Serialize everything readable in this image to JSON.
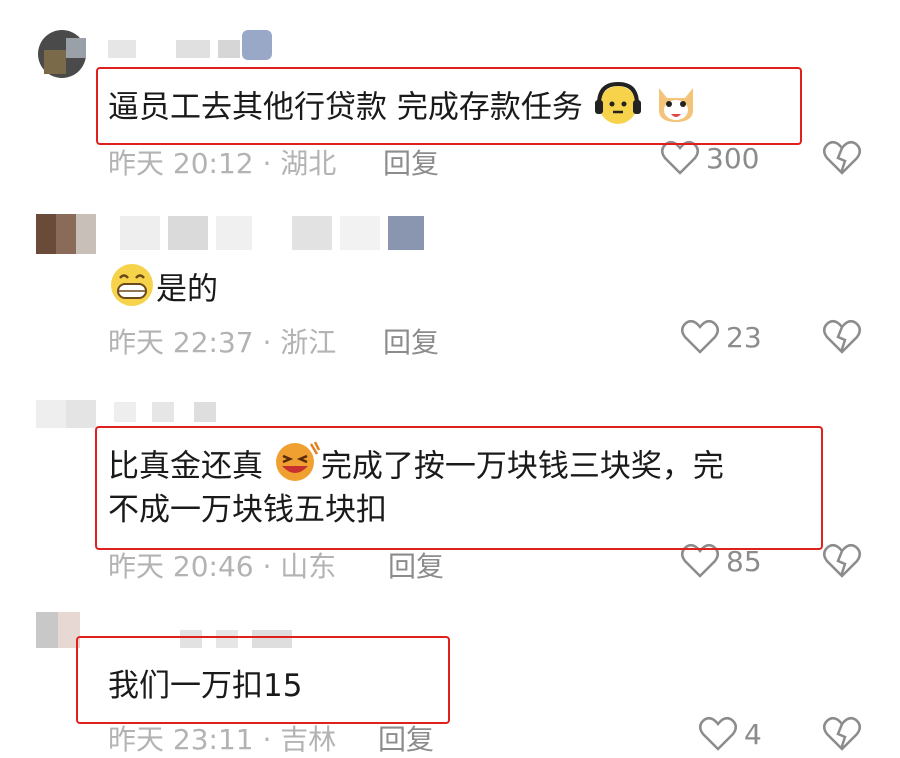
{
  "comments": [
    {
      "text": "逼员工去其他行贷款 完成存款任务",
      "meta": "昨天 20:12 · 湖北",
      "reply": "回复",
      "likes": "300"
    },
    {
      "text": "是的",
      "meta": "昨天 22:37 · 浙江",
      "reply": "回复",
      "likes": "23"
    },
    {
      "text_line1": "比真金还真",
      "text_line1b": "完成了按一万块钱三块奖，完",
      "text_line2": "不成一万块钱五块扣",
      "meta": "昨天 20:46 · 山东",
      "reply": "回复",
      "likes": "85"
    },
    {
      "text": "我们一万扣15",
      "meta": "昨天 23:11 · 吉林",
      "reply": "回复",
      "likes": "4"
    }
  ],
  "colors": {
    "highlight_box": "#e0201c",
    "meta_text": "#b3b3b3",
    "action_text": "#8c8c8c"
  },
  "icons": [
    "heart-outline-icon",
    "broken-heart-icon",
    "headphone-face-emoji",
    "dog-face-emoji",
    "grin-emoji",
    "laughing-emoji"
  ]
}
